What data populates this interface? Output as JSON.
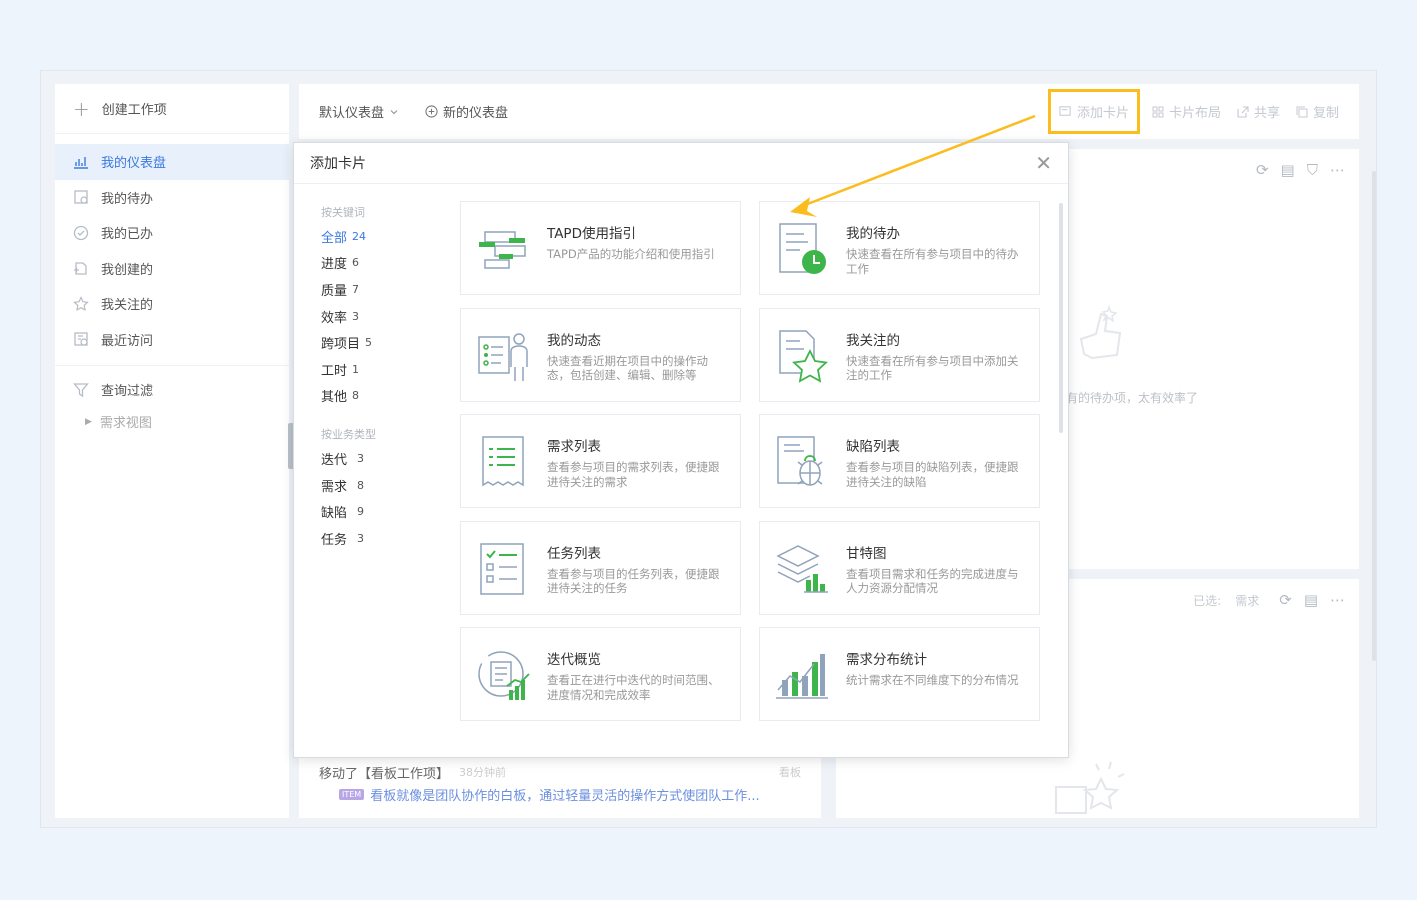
{
  "sidebar": {
    "create_label": "创建工作项",
    "items": [
      {
        "label": "我的仪表盘",
        "icon": "chart-icon"
      },
      {
        "label": "我的待办",
        "icon": "todo-icon"
      },
      {
        "label": "我的已办",
        "icon": "check-circle-icon"
      },
      {
        "label": "我创建的",
        "icon": "created-icon"
      },
      {
        "label": "我关注的",
        "icon": "star-icon"
      },
      {
        "label": "最近访问",
        "icon": "history-icon"
      }
    ],
    "filter_label": "查询过滤",
    "sub_view_label": "需求视图"
  },
  "topbar": {
    "dashboard_select": "默认仪表盘",
    "new_dashboard": "新的仪表盘",
    "add_card": "添加卡片",
    "card_layout": "卡片布局",
    "share": "共享",
    "copy": "复制"
  },
  "background": {
    "feed_action": "移动了【看板工作项】",
    "feed_time": "38分钟前",
    "feed_board": "看板",
    "feed_tag": "ITEM",
    "feed_text": "看板就像是团队协作的白板，通过轻量灵活的操作方式使团队工作...",
    "empty_text": "有的待办项，太有效率了",
    "selected_label": "已选:",
    "selected_value": "需求"
  },
  "modal": {
    "title": "添加卡片",
    "keyword_title": "按关键词",
    "keywords": [
      {
        "label": "全部",
        "count": "24"
      },
      {
        "label": "进度",
        "count": "6"
      },
      {
        "label": "质量",
        "count": "7"
      },
      {
        "label": "效率",
        "count": "3"
      },
      {
        "label": "跨项目",
        "count": "5"
      },
      {
        "label": "工时",
        "count": "1"
      },
      {
        "label": "其他",
        "count": "8"
      }
    ],
    "type_title": "按业务类型",
    "types": [
      {
        "label": "迭代",
        "count": "3"
      },
      {
        "label": "需求",
        "count": "8"
      },
      {
        "label": "缺陷",
        "count": "9"
      },
      {
        "label": "任务",
        "count": "3"
      }
    ],
    "cards": [
      {
        "title": "TAPD使用指引",
        "desc": "TAPD产品的功能介绍和使用指引"
      },
      {
        "title": "我的待办",
        "desc": "快速查看在所有参与项目中的待办工作"
      },
      {
        "title": "我的动态",
        "desc": "快速查看近期在项目中的操作动态，包括创建、编辑、删除等"
      },
      {
        "title": "我关注的",
        "desc": "快速查看在所有参与项目中添加关注的工作"
      },
      {
        "title": "需求列表",
        "desc": "查看参与项目的需求列表，便捷跟进待关注的需求"
      },
      {
        "title": "缺陷列表",
        "desc": "查看参与项目的缺陷列表，便捷跟进待关注的缺陷"
      },
      {
        "title": "任务列表",
        "desc": "查看参与项目的任务列表，便捷跟进待关注的任务"
      },
      {
        "title": "甘特图",
        "desc": "查看项目需求和任务的完成进度与人力资源分配情况"
      },
      {
        "title": "迭代概览",
        "desc": "查看正在进行中迭代的时间范围、进度情况和完成效率"
      },
      {
        "title": "需求分布统计",
        "desc": "统计需求在不同维度下的分布情况"
      }
    ]
  },
  "colors": {
    "accent": "#3a7ae0",
    "highlight": "#fbbd1e",
    "green": "#3db54a"
  }
}
